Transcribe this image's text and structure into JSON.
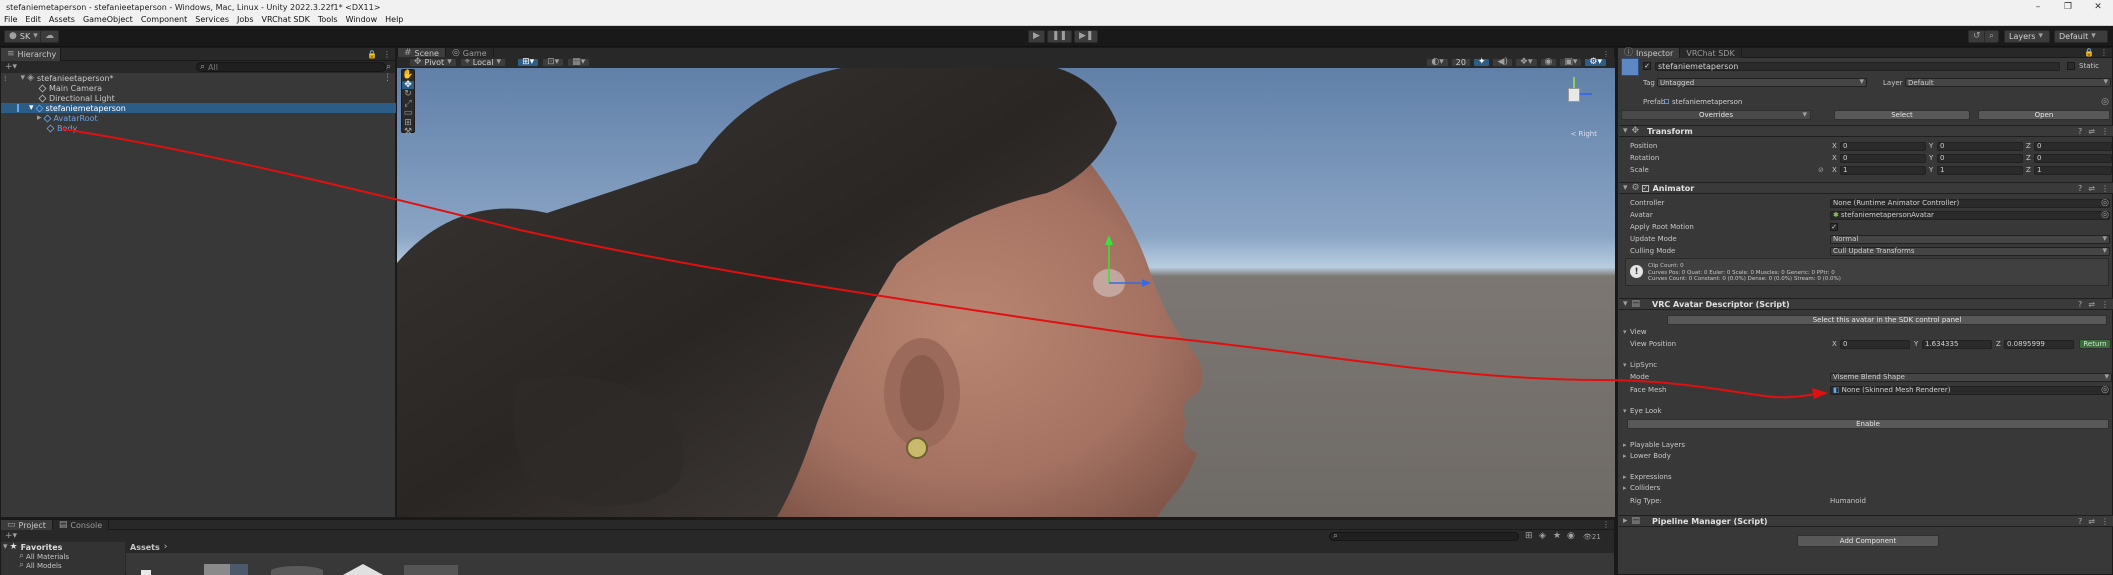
{
  "window": {
    "title": "stefaniemetaperson - stefanieetaperson - Windows, Mac, Linux - Unity 2022.3.22f1* <DX11>"
  },
  "menu": [
    "File",
    "Edit",
    "Assets",
    "GameObject",
    "Component",
    "Services",
    "Jobs",
    "VRChat SDK",
    "Tools",
    "Window",
    "Help"
  ],
  "toolbar": {
    "account_label": "SK",
    "layers_label": "Layers",
    "layout_label": "Default"
  },
  "hierarchy": {
    "tab_label": "Hierarchy",
    "search_placeholder": "All",
    "items": [
      {
        "label": "stefanieetaperson*"
      },
      {
        "label": "Main Camera"
      },
      {
        "label": "Directional Light"
      },
      {
        "label": "stefaniemetaperson"
      },
      {
        "label": "AvatarRoot"
      },
      {
        "label": "Body"
      }
    ]
  },
  "scene": {
    "tabs": [
      "Scene",
      "Game"
    ],
    "pivot_label": "Pivot",
    "local_label": "Local",
    "camera_speed": "20",
    "gizmo_label": "< Right"
  },
  "inspector": {
    "tabs": [
      "Inspector",
      "VRChat SDK"
    ],
    "object_name": "stefaniemetaperson",
    "static_label": "Static",
    "tag_label": "Tag",
    "tag_value": "Untagged",
    "layer_label": "Layer",
    "layer_value": "Default",
    "prefab_label": "Prefab",
    "prefab_value": "stefaniemetaperson",
    "overrides_label": "Overrides",
    "select_label": "Select",
    "open_label": "Open",
    "transform": {
      "title": "Transform",
      "rows": [
        {
          "label": "Position",
          "x": "0",
          "y": "0",
          "z": "0"
        },
        {
          "label": "Rotation",
          "x": "0",
          "y": "0",
          "z": "0"
        },
        {
          "label": "Scale",
          "x": "1",
          "y": "1",
          "z": "1"
        }
      ]
    },
    "animator": {
      "title": "Animator",
      "controller_label": "Controller",
      "controller_value": "None (Runtime Animator Controller)",
      "avatar_label": "Avatar",
      "avatar_value": "stefaniemetapersonAvatar",
      "root_motion_label": "Apply Root Motion",
      "update_mode_label": "Update Mode",
      "update_mode_value": "Normal",
      "culling_label": "Culling Mode",
      "culling_value": "Cull Update Transforms",
      "info_line1": "Clip Count: 0",
      "info_line2": "Curves Pos: 0 Quat: 0 Euler: 0 Scale: 0 Muscles: 0 Generic: 0 PPtr: 0",
      "info_line3": "Curves Count: 0 Constant: 0 (0.0%) Dense: 0 (0.0%) Stream: 0 (0.0%)"
    },
    "vrc": {
      "title": "VRC Avatar Descriptor (Script)",
      "select_sdk_label": "Select this avatar in the SDK control panel",
      "view_label": "View",
      "view_position_label": "View Position",
      "view_x": "0",
      "view_y": "1.634335",
      "view_z": "0.0895999",
      "return_label": "Return",
      "lipsync_label": "LipSync",
      "mode_label": "Mode",
      "mode_value": "Viseme Blend Shape",
      "face_mesh_label": "Face Mesh",
      "face_mesh_value": "None (Skinned Mesh Renderer)",
      "eye_look_label": "Eye Look",
      "enable_label": "Enable",
      "playable_layers_label": "Playable Layers",
      "lower_body_label": "Lower Body",
      "expressions_label": "Expressions",
      "colliders_label": "Colliders",
      "rig_type_label": "Rig Type:",
      "rig_type_value": "Humanoid"
    },
    "pipeline": {
      "title": "Pipeline Manager (Script)"
    },
    "add_component_label": "Add Component"
  },
  "project": {
    "tabs": [
      "Project",
      "Console"
    ],
    "favorites_label": "Favorites",
    "favorites": [
      "All Materials",
      "All Models"
    ],
    "breadcrumb": "Assets",
    "count_label": "21"
  },
  "colors": {
    "selection": "#2c5d87",
    "arrow": "#e01010",
    "accent_blue": "#6ca5e8"
  }
}
